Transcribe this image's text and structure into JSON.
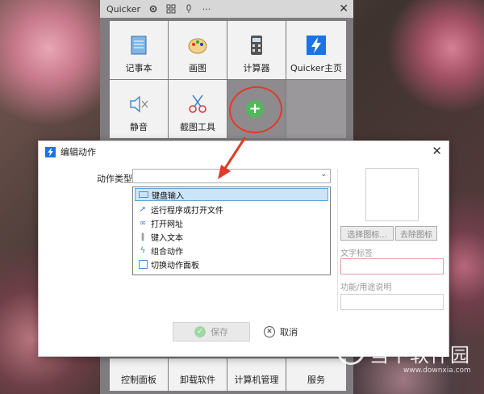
{
  "quicker": {
    "title": "Quicker",
    "tiles_row1": [
      "记事本",
      "画图",
      "计算器",
      "Quicker主页"
    ],
    "tiles_row2": [
      "静音",
      "截图工具"
    ],
    "tiles_bottom": [
      "控制面板",
      "卸载软件",
      "计算机管理",
      "服务"
    ]
  },
  "dialog": {
    "title": "编辑动作",
    "field_label": "动作类型",
    "selected_value": "",
    "options": [
      "键盘输入",
      "运行程序或打开文件",
      "打开网址",
      "键入文本",
      "组合动作",
      "切换动作面板"
    ],
    "select_icon_button": "选择图标...",
    "remove_icon_button": "去除图标",
    "text_label": "文字标签",
    "description_label": "功能/用途说明",
    "save_button": "保存",
    "cancel_button": "取消"
  },
  "watermark": {
    "name": "当下软件园",
    "url": "www.downxia.com"
  },
  "colors": {
    "accent_blue": "#1a73e8",
    "highlight": "#cce4f7",
    "red_annotation": "#e13a2a",
    "add_green": "#52b85c"
  }
}
